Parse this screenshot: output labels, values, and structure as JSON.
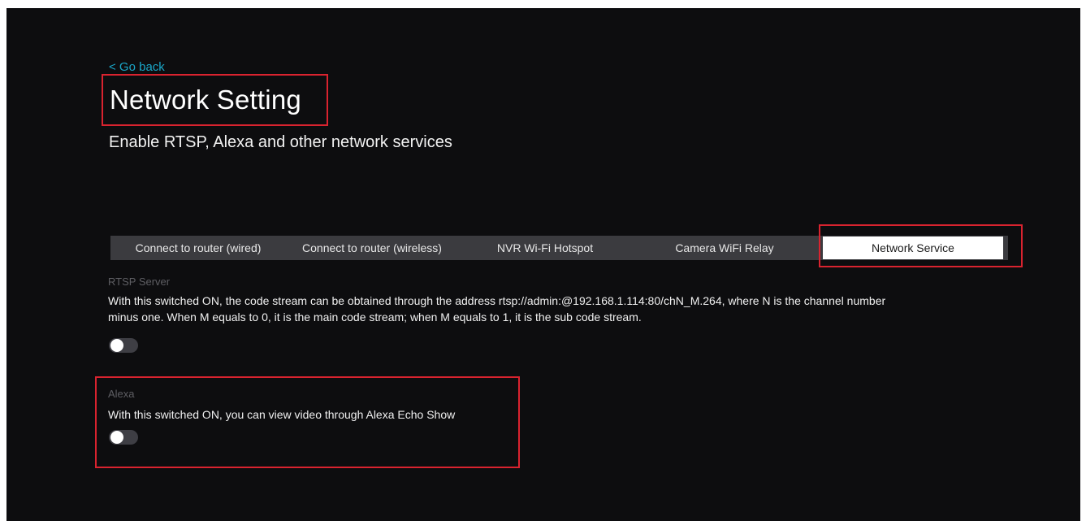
{
  "header": {
    "back_label": "< Go back",
    "title": "Network Setting",
    "subtitle": "Enable RTSP, Alexa and other network services"
  },
  "tabs": [
    {
      "label": "Connect to router (wired)",
      "active": false
    },
    {
      "label": "Connect to router (wireless)",
      "active": false
    },
    {
      "label": "NVR Wi-Fi Hotspot",
      "active": false
    },
    {
      "label": "Camera WiFi Relay",
      "active": false
    },
    {
      "label": "Network Service",
      "active": true
    }
  ],
  "rtsp": {
    "label": "RTSP Server",
    "description_line1": "With this switched ON, the code stream can be obtained through the address rtsp://admin:@192.168.1.114:80/chN_M.264, where N is the channel number",
    "description_line2": "minus one. When M equals to 0, it is the main code stream; when M equals to 1, it is the sub code stream.",
    "enabled": false
  },
  "alexa": {
    "label": "Alexa",
    "description": "With this switched ON, you can view video through Alexa Echo Show",
    "enabled": false
  },
  "colors": {
    "background": "#0d0d0f",
    "link": "#1aa6c8",
    "highlight": "#d9232f",
    "tab_bar": "#3b3b3f",
    "active_tab": "#ffffff"
  }
}
